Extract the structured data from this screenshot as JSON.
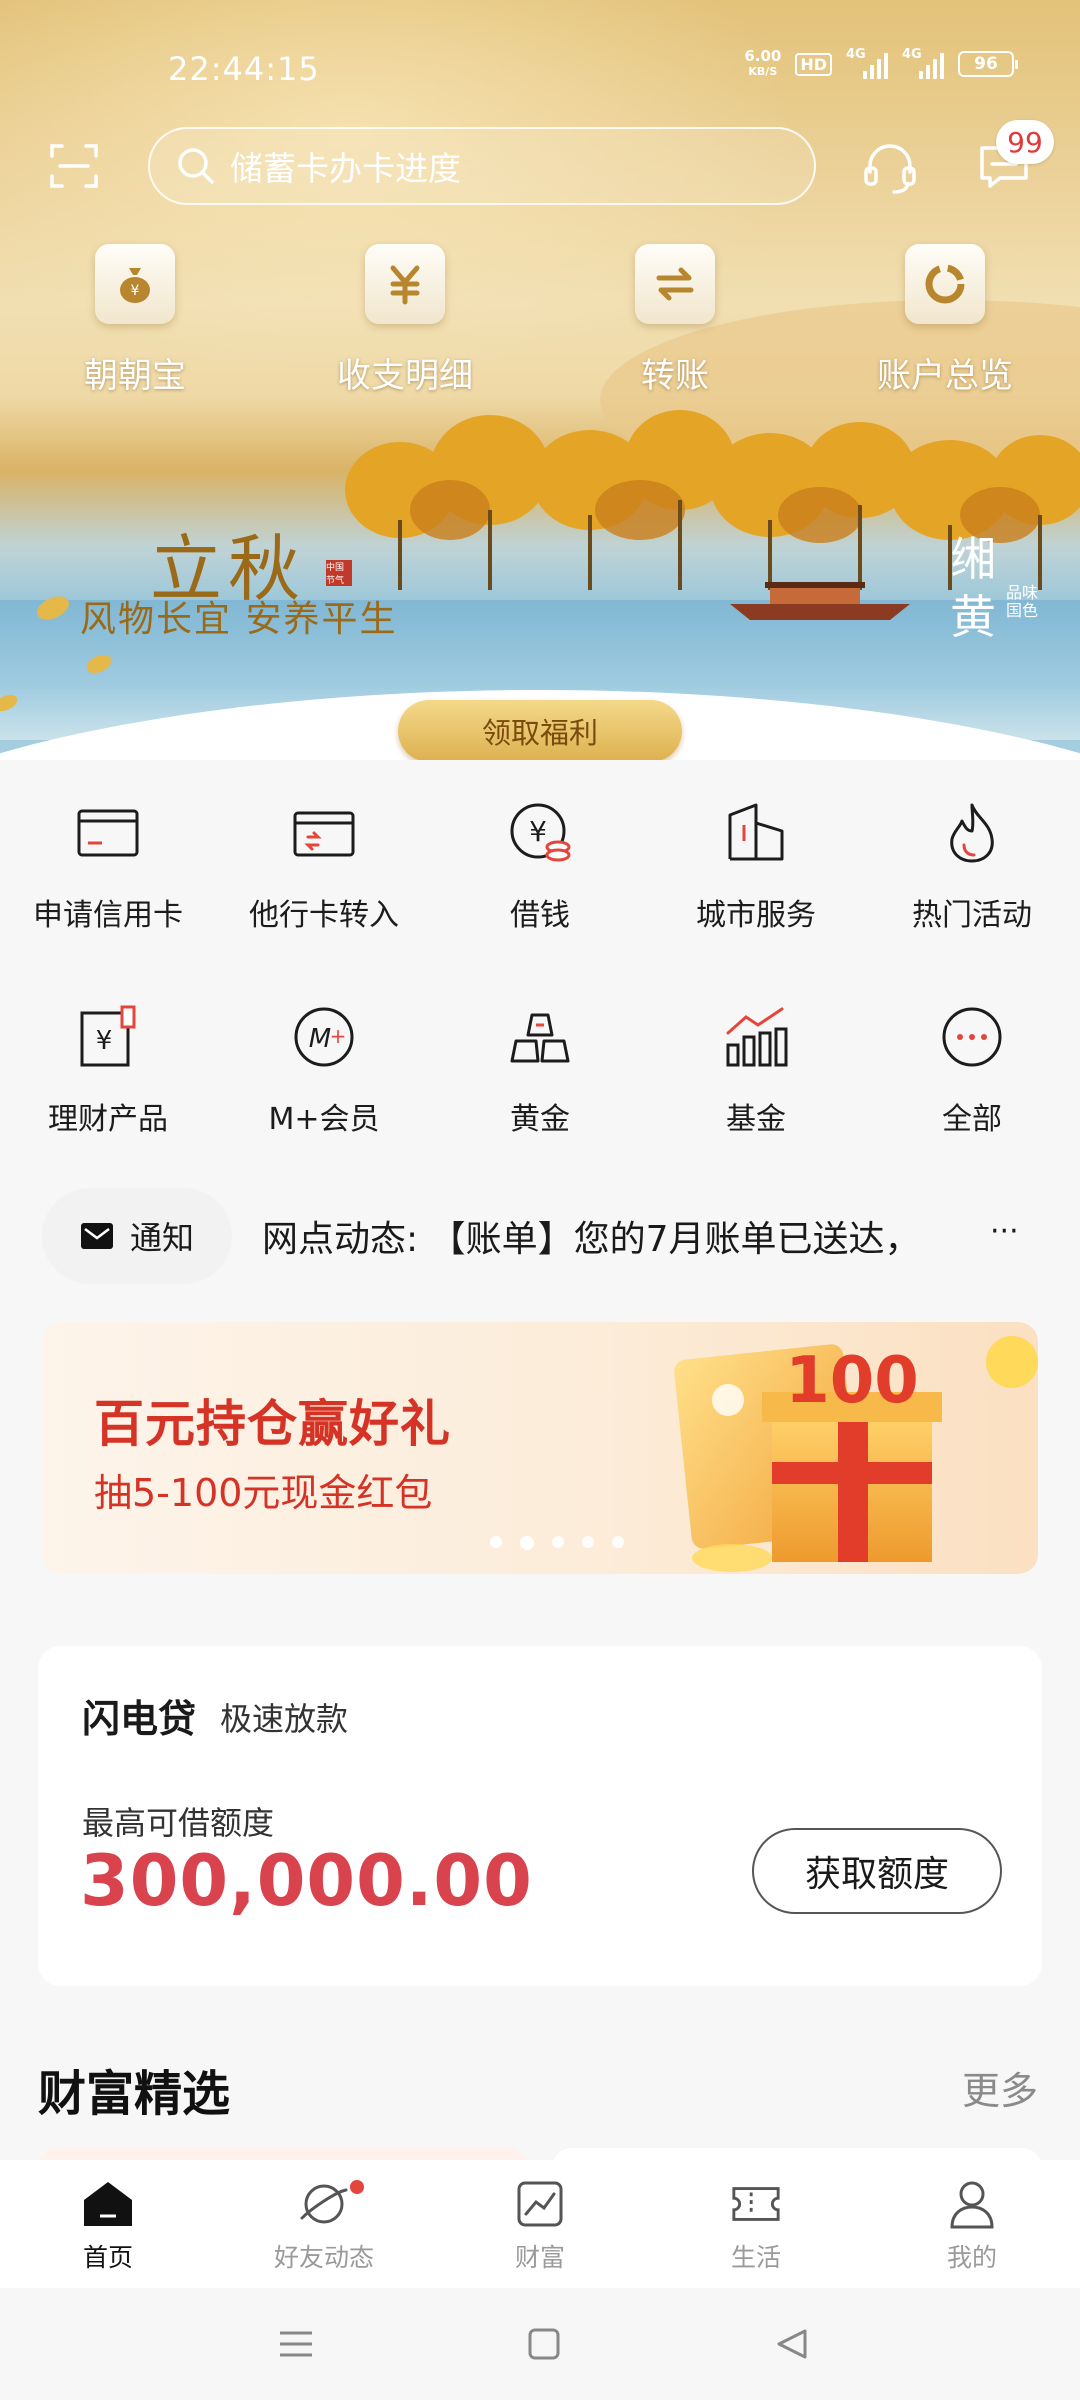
{
  "status_bar": {
    "time": "22:44:15",
    "net_speed_value": "6.00",
    "net_speed_unit": "KB/S",
    "hd": "HD",
    "sim1_type": "4G",
    "sim2_type": "4G",
    "battery": "96"
  },
  "header": {
    "search_placeholder": "储蓄卡办卡进度",
    "message_badge": "99"
  },
  "quick_actions": [
    {
      "label": "朝朝宝",
      "icon": "money-bag-icon"
    },
    {
      "label": "收支明细",
      "icon": "yuan-icon"
    },
    {
      "label": "转账",
      "icon": "transfer-arrows-icon"
    },
    {
      "label": "账户总览",
      "icon": "ring-chart-icon"
    }
  ],
  "banner": {
    "title": "立秋",
    "subtitle": "风物长宜 安养平生",
    "seal": "中国节气",
    "side_title": "缃黄",
    "side_small": "品味国色",
    "cta": "领取福利"
  },
  "services": [
    {
      "label": "申请信用卡",
      "icon": "credit-card-icon"
    },
    {
      "label": "他行卡转入",
      "icon": "card-transfer-icon"
    },
    {
      "label": "借钱",
      "icon": "loan-coin-icon"
    },
    {
      "label": "城市服务",
      "icon": "city-buildings-icon"
    },
    {
      "label": "热门活动",
      "icon": "flame-icon"
    },
    {
      "label": "理财产品",
      "icon": "wealth-product-icon"
    },
    {
      "label": "M+会员",
      "icon": "m-plus-icon"
    },
    {
      "label": "黄金",
      "icon": "gold-bars-icon"
    },
    {
      "label": "基金",
      "icon": "fund-chart-icon"
    },
    {
      "label": "全部",
      "icon": "more-dots-icon"
    }
  ],
  "notice": {
    "tag": "通知",
    "text": "网点动态: 【账单】您的7月账单已送达，",
    "more": "···"
  },
  "promo": {
    "title": "百元持仓赢好礼",
    "subtitle": "抽5-100元现金红包",
    "badge": "100"
  },
  "loan_card": {
    "title": "闪电贷",
    "tag": "极速放款",
    "label": "最高可借额度",
    "amount": "300,000.00",
    "button": "获取额度"
  },
  "wealth": {
    "title": "财富精选",
    "more": "更多"
  },
  "tabbar": [
    {
      "label": "首页",
      "icon": "home-icon",
      "active": true
    },
    {
      "label": "好友动态",
      "icon": "planet-icon",
      "active": false
    },
    {
      "label": "财富",
      "icon": "trend-chart-icon",
      "active": false
    },
    {
      "label": "生活",
      "icon": "ticket-icon",
      "active": false
    },
    {
      "label": "我的",
      "icon": "person-icon",
      "active": false
    }
  ],
  "colors": {
    "accent_red": "#d9434e",
    "promo_red": "#d53326",
    "gold": "#dcb04f"
  }
}
